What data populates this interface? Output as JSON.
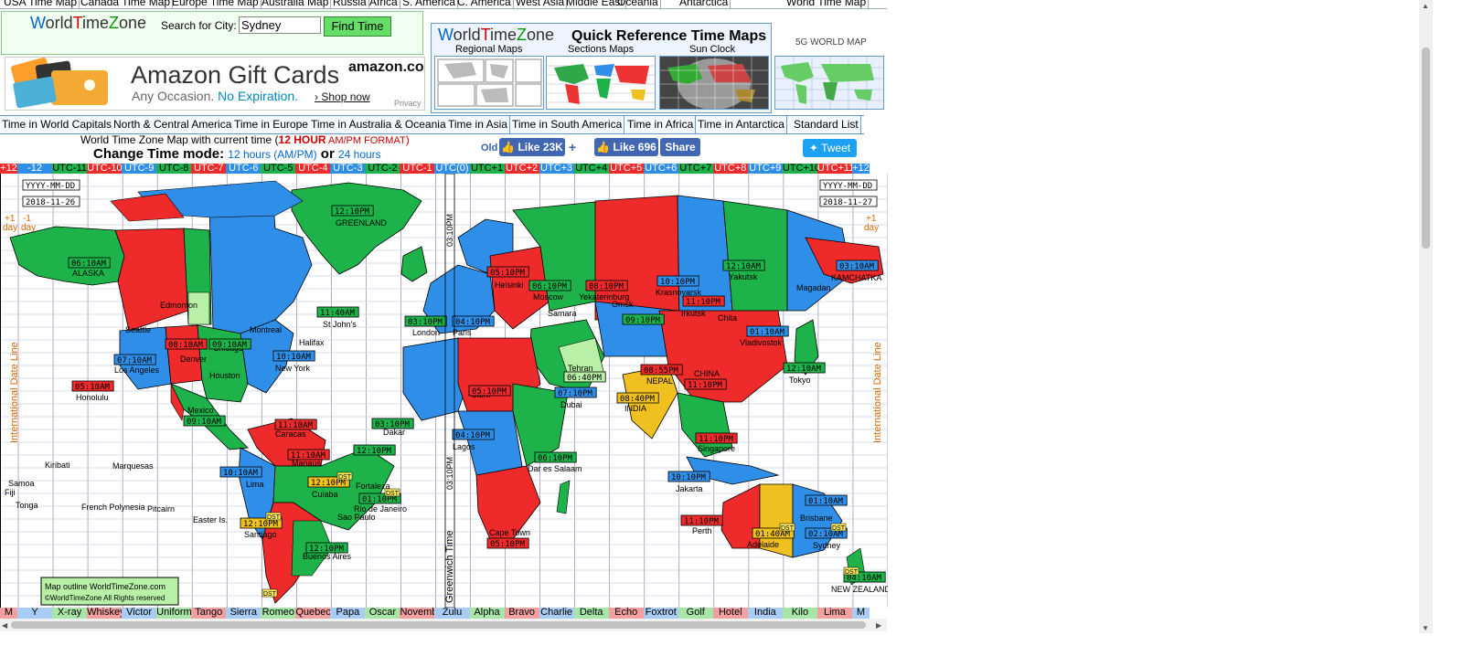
{
  "top_nav": [
    "USA Time Map",
    "Canada Time Map",
    "Europe Time Map",
    "Australia Map",
    "Russia",
    "Africa",
    "S. America",
    "C. America",
    "West Asia",
    "Middle East",
    "Oceania",
    "Antarctica",
    "World Time Map"
  ],
  "brand": {
    "w": "W",
    "orld": "orld",
    "t": "T",
    "ime": "ime",
    "z": "Z",
    "one": "one"
  },
  "search": {
    "label": "Search for City:",
    "value": "Sydney",
    "button": "Find Time"
  },
  "ad": {
    "title": "Amazon Gift Cards",
    "sub_a": "Any Occasion.",
    "sub_b": "No Expiration.",
    "shop": "Shop now",
    "brand": "amazon.com",
    "privacy": "Privacy"
  },
  "quickref": {
    "title": "Quick Reference Time Maps",
    "labels": [
      "Regional Maps",
      "Sections Maps",
      "Sun Clock"
    ],
    "fiveg": "5G WORLD MAP"
  },
  "tabs": [
    "Time in World Capitals",
    "North & Central America",
    "Time in Europe",
    "Time in Australia & Oceania",
    "Time in Asia",
    "Time in South America",
    "Time in Africa",
    "Time in Antarctica",
    "Standard List"
  ],
  "heading": {
    "prefix": "World Time Zone Map with current time (",
    "fmt_a": "12 HOUR",
    "fmt_b": " AM/PM FORMAT",
    "suffix": ")",
    "mode": "Change Time mode:",
    "opt12": "12 hours (AM/PM)",
    "or": "or",
    "opt24": "24 hours"
  },
  "social": {
    "old": "Old",
    "like1": "Like 23K",
    "plus": "+",
    "like2": "Like 696",
    "share": "Share",
    "tweet": "Tweet"
  },
  "utc_zones": [
    "+12",
    "-12",
    "UTC-11",
    "UTC-10",
    "UTC-9",
    "UTC-8",
    "UTC-7",
    "UTC-6",
    "UTC-5",
    "UTC-4",
    "UTC-3",
    "UTC-2",
    "UTC-1",
    "UTC(0)",
    "UTC+1",
    "UTC+2",
    "UTC+3",
    "UTC+4",
    "UTC+5",
    "UTC+6",
    "UTC+7",
    "UTC+8",
    "UTC+9",
    "UTC+10",
    "UTC+11",
    "+12"
  ],
  "nato_zones": [
    "M",
    "Y",
    "X-ray",
    "Whiskey",
    "Victor",
    "Uniform",
    "Tango",
    "Sierra",
    "Romeo",
    "Quebec",
    "Papa",
    "Oscar",
    "Novemb",
    "Zulu",
    "Alpha",
    "Bravo",
    "Charlie",
    "Delta",
    "Echo",
    "Foxtrot",
    "Golf",
    "Hotel",
    "India",
    "Kilo",
    "Lima",
    "M"
  ],
  "map": {
    "dates": {
      "left_label": "YYYY-MM-DD",
      "left_date": "2018-11-26",
      "right_label": "YYYY-MM-DD",
      "right_date": "2018-11-27",
      "plus1": "+1",
      "day": "day",
      "minus1": "-1"
    },
    "idl": "International Date Line",
    "gmt": "Greenwich Time",
    "gmt_time": "03:10PM",
    "credit1": "Map outline WorldTimeZone.com",
    "credit2": "©WorldTimeZone All Rights reserved",
    "dst": "DST",
    "cities": [
      {
        "name": "ALASKA",
        "time": "06:10AM"
      },
      {
        "name": "GREENLAND",
        "time": "12:10PM"
      },
      {
        "name": "Edmonton",
        "time": ""
      },
      {
        "name": "Seattle",
        "time": ""
      },
      {
        "name": "Denver",
        "time": "08:10AM"
      },
      {
        "name": "Chicago",
        "time": "09:10AM"
      },
      {
        "name": "Los Angeles",
        "time": "07:10AM"
      },
      {
        "name": "Montreal",
        "time": ""
      },
      {
        "name": "St John's",
        "time": "11:40AM"
      },
      {
        "name": "Halifax",
        "time": ""
      },
      {
        "name": "New York",
        "time": "10:10AM"
      },
      {
        "name": "Houston",
        "time": ""
      },
      {
        "name": "Honolulu",
        "time": "05:10AM"
      },
      {
        "name": "Mexico",
        "time": "09:10AM"
      },
      {
        "name": "Caracas",
        "time": "11:10AM"
      },
      {
        "name": "Manaus",
        "time": "11:10AM"
      },
      {
        "name": "Lima",
        "time": "10:10AM"
      },
      {
        "name": "Cuiaba",
        "time": "12:10PM"
      },
      {
        "name": "Fortaleza",
        "time": "12:10PM"
      },
      {
        "name": "Rio de Janeiro",
        "time": "01:10PM"
      },
      {
        "name": "Sao Paulo",
        "time": ""
      },
      {
        "name": "Santiago",
        "time": "12:10PM"
      },
      {
        "name": "Buenos Aires",
        "time": "12:10PM"
      },
      {
        "name": "Easter Is.",
        "time": ""
      },
      {
        "name": "Pitcairn",
        "time": ""
      },
      {
        "name": "Marquesas",
        "time": ""
      },
      {
        "name": "Kiribati",
        "time": ""
      },
      {
        "name": "Samoa",
        "time": ""
      },
      {
        "name": "Fiji",
        "time": ""
      },
      {
        "name": "Tonga",
        "time": ""
      },
      {
        "name": "French Polynesia",
        "time": ""
      },
      {
        "name": "London",
        "time": "03:10PM"
      },
      {
        "name": "Paris",
        "time": "04:10PM"
      },
      {
        "name": "Dakar",
        "time": "03:10PM"
      },
      {
        "name": "Lagos",
        "time": "04:10PM"
      },
      {
        "name": "Helsinki",
        "time": "05:10PM"
      },
      {
        "name": "Moscow",
        "time": "06:10PM"
      },
      {
        "name": "Samara",
        "time": ""
      },
      {
        "name": "Yekaterinburg",
        "time": "08:10PM"
      },
      {
        "name": "Omsk",
        "time": "09:10PM"
      },
      {
        "name": "Cairo",
        "time": "05:10PM"
      },
      {
        "name": "Tehran",
        "time": "06:40PM"
      },
      {
        "name": "Dubai",
        "time": "07:10PM"
      },
      {
        "name": "Dar es Salaam",
        "time": "06:10PM"
      },
      {
        "name": "Cape Town",
        "time": "05:10PM"
      },
      {
        "name": "INDIA",
        "time": "08:40PM"
      },
      {
        "name": "NEPAL",
        "time": "08:55PM"
      },
      {
        "name": "Krasnoyarsk",
        "time": "10:10PM"
      },
      {
        "name": "Irkutsk",
        "time": "11:10PM"
      },
      {
        "name": "Chita",
        "time": ""
      },
      {
        "name": "CHINA",
        "time": "11:10PM"
      },
      {
        "name": "Singapore",
        "time": "11:10PM"
      },
      {
        "name": "Jakarta",
        "time": "10:10PM"
      },
      {
        "name": "Perth",
        "time": "11:10PM"
      },
      {
        "name": "Yakutsk",
        "time": "12:10AM"
      },
      {
        "name": "Vladivostok",
        "time": "01:10AM"
      },
      {
        "name": "Tokyo",
        "time": "12:10AM"
      },
      {
        "name": "Magadan",
        "time": ""
      },
      {
        "name": "KAMCHATKA",
        "time": "03:10AM"
      },
      {
        "name": "Adelaide",
        "time": "01:40AM"
      },
      {
        "name": "Brisbane",
        "time": "01:10AM"
      },
      {
        "name": "Sydney",
        "time": "02:10AM"
      },
      {
        "name": "NEW ZEALAND",
        "time": "04:10AM"
      }
    ]
  },
  "colors": {
    "green": "#1db34a",
    "red": "#ee2a2a",
    "blue": "#2f8fe8",
    "yellow": "#f0c020",
    "lightgreen": "#b8f0a8"
  }
}
